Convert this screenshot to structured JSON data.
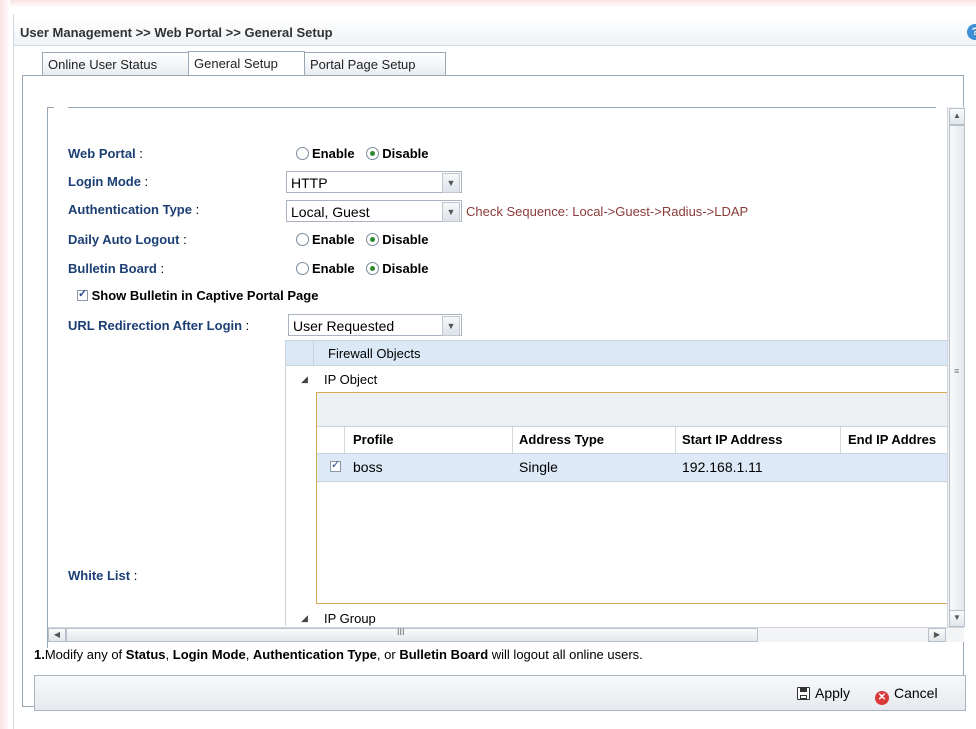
{
  "title": "User Management >> Web Portal >> General Setup",
  "tabs": [
    {
      "label": "Online User Status",
      "active": false
    },
    {
      "label": "General Setup",
      "active": true
    },
    {
      "label": "Portal Page Setup",
      "active": false
    }
  ],
  "form": {
    "web_portal": {
      "label": "Web Portal",
      "colon": " :",
      "enable": "Enable",
      "disable": "Disable",
      "selected": "Disable"
    },
    "login_mode": {
      "label": "Login Mode",
      "colon": " :",
      "value": "HTTP"
    },
    "auth_type": {
      "label": "Authentication Type",
      "colon": " :",
      "value": "Local, Guest",
      "hint": "Check Sequence: Local->Guest->Radius->LDAP"
    },
    "daily_auto_logout": {
      "label": "Daily Auto Logout",
      "colon": " :",
      "enable": "Enable",
      "disable": "Disable",
      "selected": "Disable"
    },
    "bulletin_board": {
      "label": "Bulletin Board",
      "colon": " :",
      "enable": "Enable",
      "disable": "Disable",
      "selected": "Disable"
    },
    "show_bulletin": {
      "label": "Show Bulletin in Captive Portal Page",
      "checked": true
    },
    "url_redirect": {
      "label": "URL Redirection After Login",
      "colon": " :",
      "value": "User Requested"
    },
    "white_list": {
      "label": "White List",
      "colon": " :"
    }
  },
  "tree": {
    "header": "Firewall Objects",
    "ip_object": "IP Object",
    "ip_group": "IP Group",
    "columns": [
      "Profile",
      "Address Type",
      "Start IP Address",
      "End IP Addres"
    ],
    "rows": [
      {
        "checked": true,
        "profile": "boss",
        "address_type": "Single",
        "start_ip": "192.168.1.11",
        "end_ip": ""
      }
    ]
  },
  "note": {
    "prefix": "1.",
    "p1": "Modify any of ",
    "b1": "Status",
    "p2": ", ",
    "b2": "Login Mode",
    "p3": ", ",
    "b3": "Authentication Type",
    "p4": ", or ",
    "b4": "Bulletin Board",
    "p5": " will logout all online users."
  },
  "footer": {
    "apply": "Apply",
    "cancel": "Cancel"
  },
  "icons": {
    "help": "help-icon",
    "save": "save-icon",
    "cancel": "cancel-icon"
  }
}
